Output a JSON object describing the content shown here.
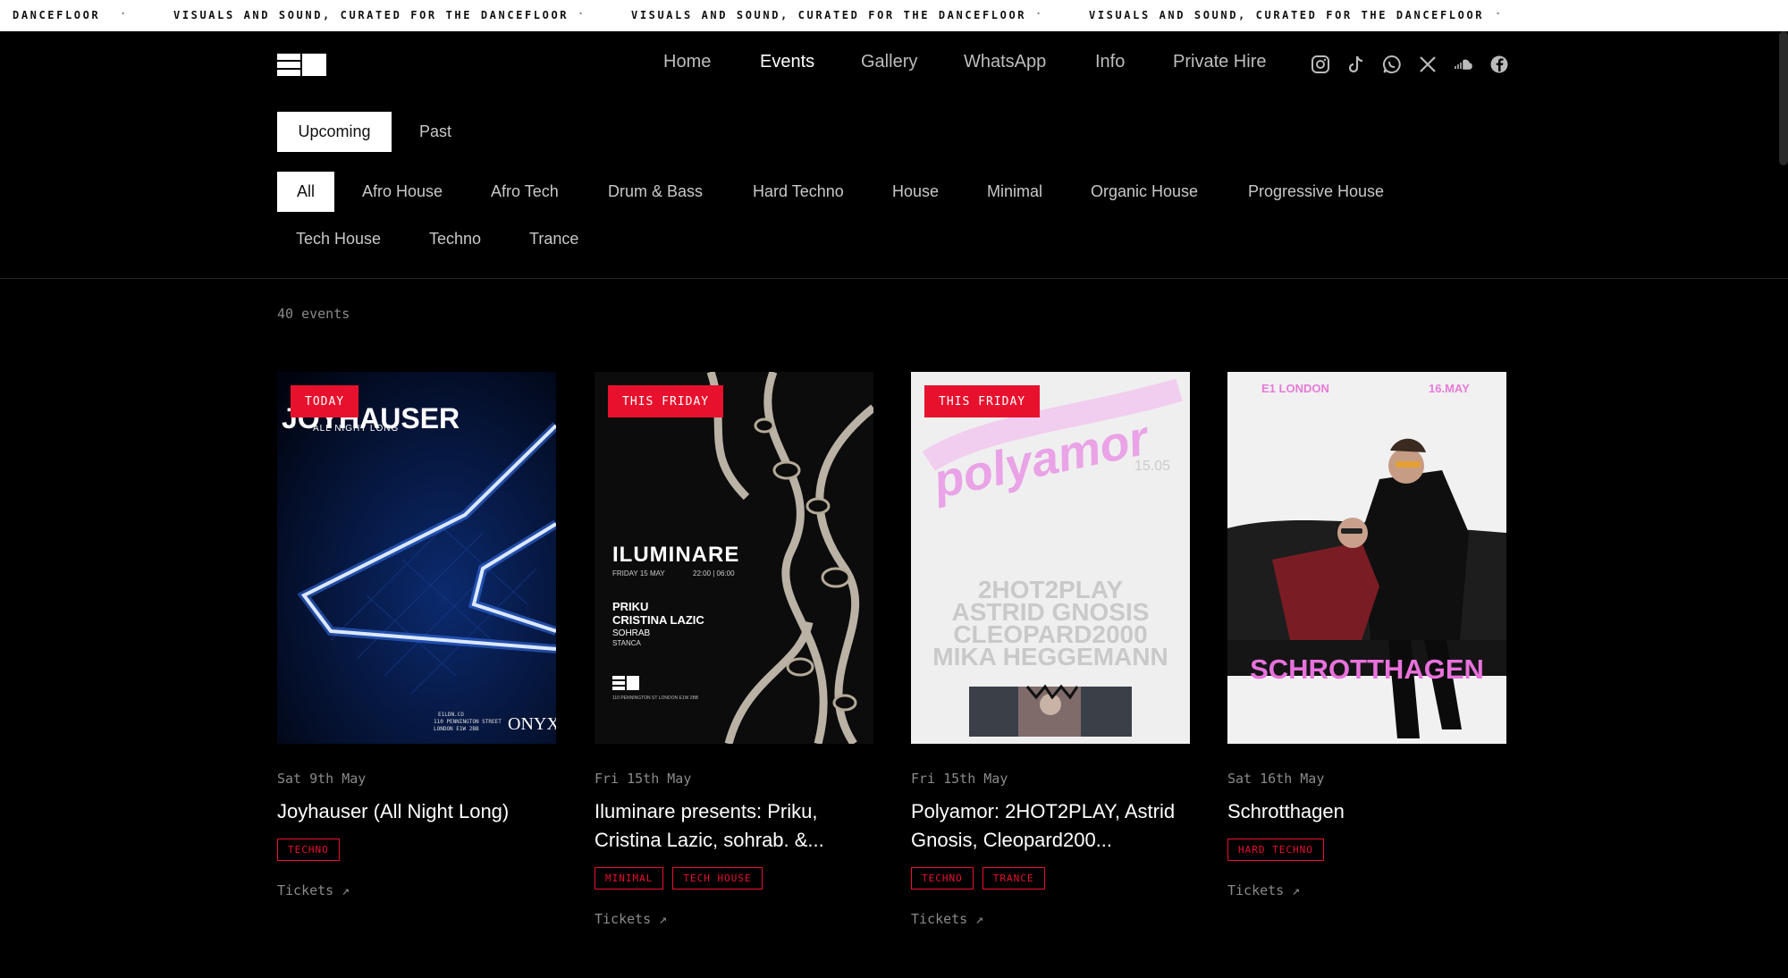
{
  "ticker": {
    "text": "VISUALS AND SOUND, CURATED FOR THE DANCEFLOOR",
    "partial": "DANCEFLOOR",
    "separator": "·"
  },
  "nav": {
    "items": [
      {
        "label": "Home",
        "active": false
      },
      {
        "label": "Events",
        "active": true
      },
      {
        "label": "Gallery",
        "active": false
      },
      {
        "label": "WhatsApp",
        "active": false
      },
      {
        "label": "Info",
        "active": false
      },
      {
        "label": "Private Hire",
        "active": false
      }
    ],
    "social_icons": [
      "instagram-icon",
      "tiktok-icon",
      "whatsapp-icon",
      "x-icon",
      "soundcloud-icon",
      "facebook-icon"
    ]
  },
  "tabs": [
    {
      "label": "Upcoming",
      "active": true
    },
    {
      "label": "Past",
      "active": false
    }
  ],
  "filters": [
    {
      "label": "All",
      "active": true
    },
    {
      "label": "Afro House"
    },
    {
      "label": "Afro Tech"
    },
    {
      "label": "Drum & Bass"
    },
    {
      "label": "Hard Techno"
    },
    {
      "label": "House"
    },
    {
      "label": "Minimal"
    },
    {
      "label": "Organic House"
    },
    {
      "label": "Progressive House"
    },
    {
      "label": "Tech House"
    },
    {
      "label": "Techno"
    },
    {
      "label": "Trance"
    }
  ],
  "event_count": "40 events",
  "events": [
    {
      "badge": "TODAY",
      "date": "Sat 9th May",
      "title": "Joyhauser (All Night Long)",
      "tags": [
        "TECHNO"
      ],
      "tickets": "Tickets ↗",
      "poster": {
        "line1": "JOYHAUSER",
        "line2": "ALL NIGHT LONG",
        "brand": "ONYX",
        "small1": "E1LDN.CO",
        "small2": "110 PENNINGTON STREET",
        "small3": "LONDON E1W 2BB"
      }
    },
    {
      "badge": "THIS FRIDAY",
      "date": "Fri 15th May",
      "title": "Iluminare presents: Priku, Cristina Lazic, sohrab. &...",
      "tags": [
        "MINIMAL",
        "TECH HOUSE"
      ],
      "tickets": "Tickets ↗",
      "poster": {
        "name": "ILUMINARE",
        "when": "FRIDAY 15 MAY",
        "time": "22:00 | 06:00",
        "a1": "PRIKU",
        "a2": "CRISTINA LAZIC",
        "a3": "SOHRAB",
        "a4": "STANCA",
        "addr": "110 PENNINGTON ST LONDON E1W 2BB"
      }
    },
    {
      "badge": "THIS FRIDAY",
      "date": "Fri 15th May",
      "title": "Polyamor: 2HOT2PLAY, Astrid Gnosis, Cleopard200...",
      "tags": [
        "TECHNO",
        "TRANCE"
      ],
      "tickets": "Tickets ↗",
      "poster": {
        "name": "polyamor",
        "date": "15.05",
        "a1": "2HOT2PLAY",
        "a2": "ASTRID GNOSIS",
        "a3": "CLEOPARD2000",
        "a4": "MIKA HEGGEMANN"
      }
    },
    {
      "badge": "",
      "date": "Sat 16th May",
      "title": "Schrotthagen",
      "tags": [
        "HARD TECHNO"
      ],
      "tickets": "Tickets ↗",
      "poster": {
        "left": "E1 LONDON",
        "right": "16.MAY",
        "name": "SCHROTTHAGEN"
      }
    }
  ],
  "colors": {
    "accent": "#e8112d",
    "background": "#000000",
    "muted": "#8a8a8a"
  }
}
